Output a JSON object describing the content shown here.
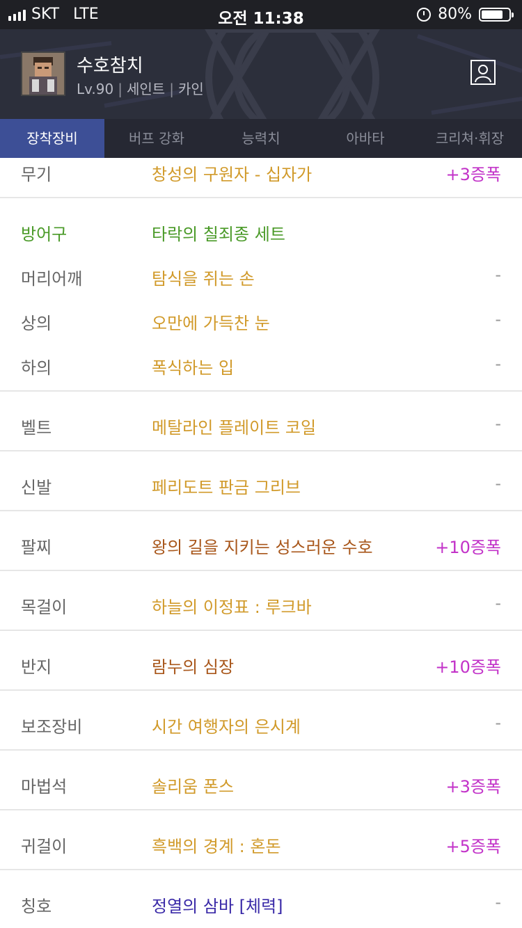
{
  "status_bar": {
    "carrier": "SKT",
    "network": "LTE",
    "time": "오전 11:38",
    "battery": "80%",
    "battery_level": 0.8
  },
  "header": {
    "name": "수호참치",
    "level": "Lv.90",
    "job": "세인트",
    "server": "카인",
    "separator": "|"
  },
  "tabs": [
    {
      "label": "장착장비",
      "active": true
    },
    {
      "label": "버프 강화",
      "active": false
    },
    {
      "label": "능력치",
      "active": false
    },
    {
      "label": "아바타",
      "active": false
    },
    {
      "label": "크리쳐·휘장",
      "active": false
    }
  ],
  "equipment": [
    {
      "slot": "무기",
      "item": "창성의 구원자 - 십자가",
      "augment": "+3증폭",
      "item_color": "#d19a2a",
      "slot_color": "#666666"
    },
    {
      "slot": "방어구",
      "item": "타락의 칠죄종 세트",
      "augment": "",
      "item_color": "#4a9a28",
      "slot_color": "#4a9a28"
    },
    {
      "slot": "머리어깨",
      "item": "탐식을 쥐는 손",
      "augment": "-",
      "item_color": "#d19a2a",
      "slot_color": "#666666"
    },
    {
      "slot": "상의",
      "item": "오만에 가득찬 눈",
      "augment": "-",
      "item_color": "#d19a2a",
      "slot_color": "#666666"
    },
    {
      "slot": "하의",
      "item": "폭식하는 입",
      "augment": "-",
      "item_color": "#d19a2a",
      "slot_color": "#666666"
    },
    {
      "slot": "벨트",
      "item": "메탈라인 플레이트 코일",
      "augment": "-",
      "item_color": "#d19a2a",
      "slot_color": "#666666"
    },
    {
      "slot": "신발",
      "item": "페리도트 판금 그리브",
      "augment": "-",
      "item_color": "#d19a2a",
      "slot_color": "#666666"
    },
    {
      "slot": "팔찌",
      "item": "왕의 길을 지키는 성스러운 수호",
      "augment": "+10증폭",
      "item_color": "#a8561a",
      "slot_color": "#666666"
    },
    {
      "slot": "목걸이",
      "item": "하늘의 이정표 : 루크바",
      "augment": "-",
      "item_color": "#d19a2a",
      "slot_color": "#666666"
    },
    {
      "slot": "반지",
      "item": "람누의 심장",
      "augment": "+10증폭",
      "item_color": "#a8561a",
      "slot_color": "#666666"
    },
    {
      "slot": "보조장비",
      "item": "시간 여행자의 은시계",
      "augment": "-",
      "item_color": "#d19a2a",
      "slot_color": "#666666"
    },
    {
      "slot": "마법석",
      "item": "솔리움 폰스",
      "augment": "+3증폭",
      "item_color": "#d19a2a",
      "slot_color": "#666666"
    },
    {
      "slot": "귀걸이",
      "item": "흑백의 경계 : 혼돈",
      "augment": "+5증폭",
      "item_color": "#d19a2a",
      "slot_color": "#666666"
    },
    {
      "slot": "칭호",
      "item": "정열의 삼바 [체력]",
      "augment": "-",
      "item_color": "#3a2aa8",
      "slot_color": "#666666"
    }
  ]
}
